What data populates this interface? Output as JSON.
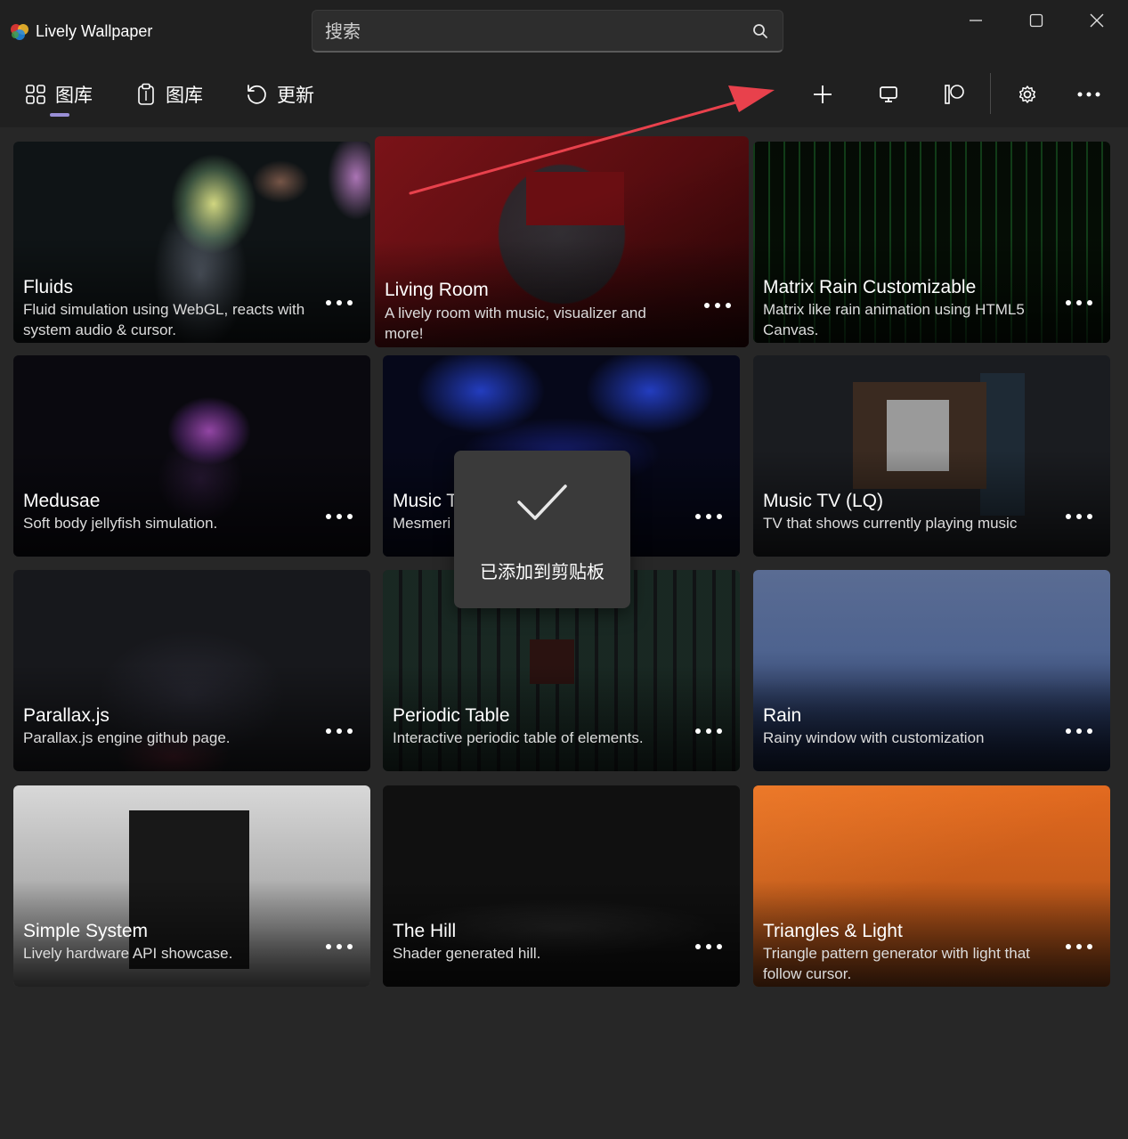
{
  "app": {
    "title": "Lively Wallpaper"
  },
  "search": {
    "placeholder": "搜索",
    "value": ""
  },
  "nav": {
    "items": [
      {
        "label": "图库",
        "icon": "grid-icon",
        "selected": true
      },
      {
        "label": "图库",
        "icon": "clipboard-icon",
        "selected": false
      },
      {
        "label": "更新",
        "icon": "refresh-icon",
        "selected": false
      }
    ]
  },
  "toolbar": [
    "add-icon",
    "monitor-icon",
    "patreon-icon",
    "gear-icon",
    "more-icon"
  ],
  "colors": {
    "window_bg": "#202020",
    "content_bg": "#272727",
    "accent": "#9a8fd6",
    "arrow": "#e8414c"
  },
  "wallpapers": [
    {
      "title": "Fluids",
      "description": "Fluid simulation using WebGL, reacts with system audio & cursor."
    },
    {
      "title": "Living Room",
      "description": "A lively room with music, visualizer and more!"
    },
    {
      "title": "Matrix Rain Customizable",
      "description": "Matrix like rain animation using HTML5 Canvas."
    },
    {
      "title": "Medusae",
      "description": "Soft body jellyfish simulation."
    },
    {
      "title": "Music T",
      "description": "Mesmeri"
    },
    {
      "title": "Music TV (LQ)",
      "description": "TV that shows currently playing music"
    },
    {
      "title": "Parallax.js",
      "description": "Parallax.js engine github page."
    },
    {
      "title": "Periodic Table",
      "description": "Interactive periodic table of elements."
    },
    {
      "title": "Rain",
      "description": "Rainy window with customization"
    },
    {
      "title": "Simple System",
      "description": "Lively hardware API showcase."
    },
    {
      "title": "The Hill",
      "description": "Shader generated hill."
    },
    {
      "title": "Triangles & Light",
      "description": "Triangle pattern generator with light that follow cursor."
    }
  ],
  "toast": {
    "message": "已添加到剪贴板"
  }
}
